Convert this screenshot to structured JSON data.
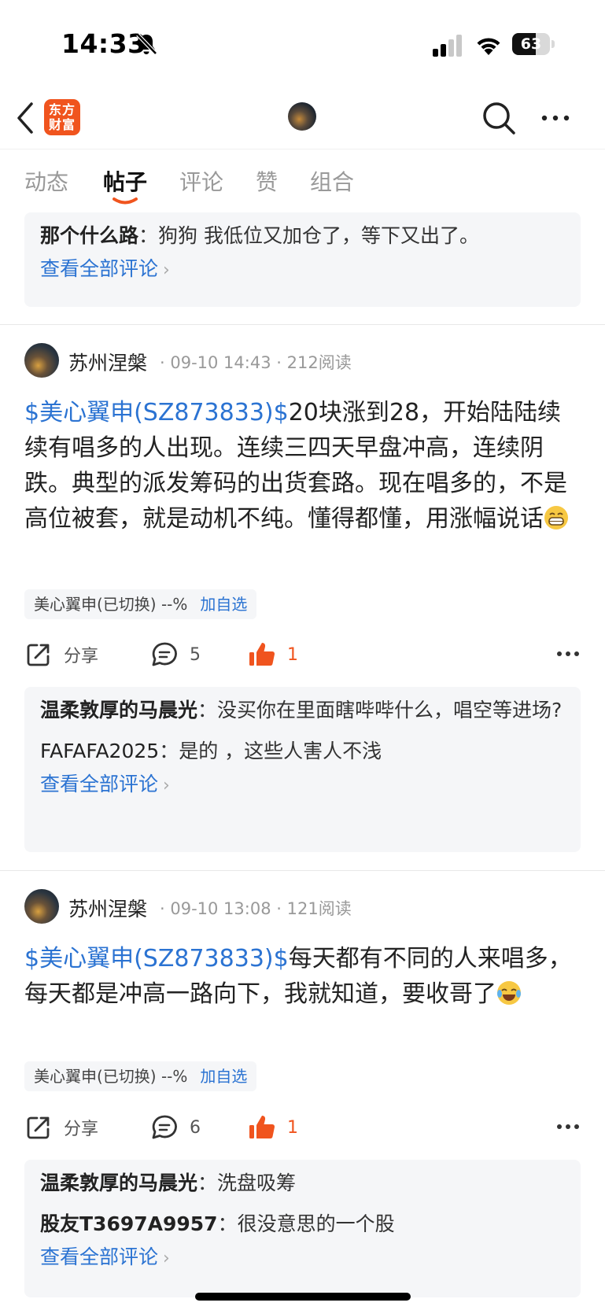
{
  "status_bar": {
    "time": "14:33",
    "battery": "63",
    "battery_level": 0.63
  },
  "nav": {
    "logo_line1": "东方",
    "logo_line2": "财富",
    "brand_color": "#f0541e"
  },
  "tabs": [
    {
      "label": "动态",
      "active": false
    },
    {
      "label": "帖子",
      "active": true
    },
    {
      "label": "评论",
      "active": false
    },
    {
      "label": "赞",
      "active": false
    },
    {
      "label": "组合",
      "active": false
    }
  ],
  "top_comments": {
    "items": [
      {
        "author": "那个什么路",
        "text": "狗狗 我低位又加仓了，等下又出了。"
      }
    ],
    "view_all": "查看全部评论"
  },
  "posts": [
    {
      "author": "苏州涅槃",
      "date": "09-10 14:43",
      "reads": "212阅读",
      "stock_link": "$美心翼申(SZ873833)$",
      "text": "20块涨到28，开始陆陆续续有唱多的人出现。连续三四天早盘冲高，连续阴跌。典型的派发筹码的出货套路。现在唱多的，不是高位被套，就是动机不纯。懂得都懂，用涨幅说话",
      "emoji": "grinning-face-emoji",
      "stock_tag": "美心翼申(已切换) --%",
      "add_watchlist": "加自选",
      "share": "分享",
      "comment_count": "5",
      "like_count": "1",
      "comments": [
        {
          "author": "温柔敦厚的马晨光",
          "text": "没买你在里面瞎哔哔什么，唱空等进场?"
        },
        {
          "author": "FAFAFA2025",
          "text": "是的 ，这些人害人不浅"
        }
      ],
      "view_all": "查看全部评论"
    },
    {
      "author": "苏州涅槃",
      "date": "09-10 13:08",
      "reads": "121阅读",
      "stock_link": "$美心翼申(SZ873833)$",
      "text": "每天都有不同的人来唱多，每天都是冲高一路向下，我就知道，要收哥了",
      "emoji": "tears-of-joy-emoji",
      "stock_tag": "美心翼申(已切换) --%",
      "add_watchlist": "加自选",
      "share": "分享",
      "comment_count": "6",
      "like_count": "1",
      "comments": [
        {
          "author": "温柔敦厚的马晨光",
          "text": "洗盘吸筹"
        },
        {
          "author": "股友T3697A9957",
          "text": "很没意思的一个股"
        }
      ],
      "view_all": "查看全部评论"
    }
  ],
  "colors": {
    "link": "#2b73d2",
    "accent": "#f0541e",
    "comment_bg": "#f5f6f8"
  }
}
